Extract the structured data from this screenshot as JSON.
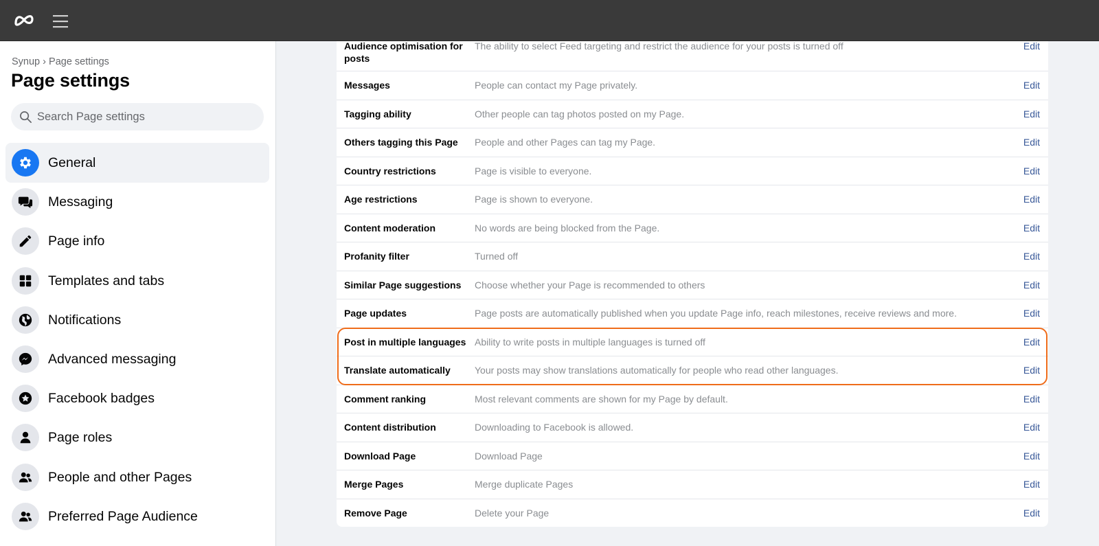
{
  "topbar": {
    "logo_icon": "meta-logo-icon",
    "menu_icon": "hamburger-menu-icon"
  },
  "sidebar": {
    "breadcrumb": {
      "parent": "Synup",
      "separator": "›",
      "current": "Page settings"
    },
    "title": "Page settings",
    "search": {
      "placeholder": "Search Page settings",
      "value": ""
    },
    "items": [
      {
        "label": "General",
        "icon": "gear-icon",
        "active": true
      },
      {
        "label": "Messaging",
        "icon": "chat-bubbles-icon"
      },
      {
        "label": "Page info",
        "icon": "pencil-icon"
      },
      {
        "label": "Templates and tabs",
        "icon": "grid-icon"
      },
      {
        "label": "Notifications",
        "icon": "globe-icon"
      },
      {
        "label": "Advanced messaging",
        "icon": "messenger-icon"
      },
      {
        "label": "Facebook badges",
        "icon": "star-badge-icon"
      },
      {
        "label": "Page roles",
        "icon": "person-icon"
      },
      {
        "label": "People and other Pages",
        "icon": "people-icon"
      },
      {
        "label": "Preferred Page Audience",
        "icon": "people-icon"
      }
    ]
  },
  "settings": {
    "edit_label": "Edit",
    "highlight_color": "#ef6c1a",
    "rows": [
      {
        "name": "Audience optimisation for posts",
        "desc": "The ability to select Feed targeting and restrict the audience for your posts is turned off"
      },
      {
        "name": "Messages",
        "desc": "People can contact my Page privately."
      },
      {
        "name": "Tagging ability",
        "desc": "Other people can tag photos posted on my Page."
      },
      {
        "name": "Others tagging this Page",
        "desc": "People and other Pages can tag my Page."
      },
      {
        "name": "Country restrictions",
        "desc": "Page is visible to everyone."
      },
      {
        "name": "Age restrictions",
        "desc": "Page is shown to everyone."
      },
      {
        "name": "Content moderation",
        "desc": "No words are being blocked from the Page."
      },
      {
        "name": "Profanity filter",
        "desc": "Turned off"
      },
      {
        "name": "Similar Page suggestions",
        "desc": "Choose whether your Page is recommended to others"
      },
      {
        "name": "Page updates",
        "desc": "Page posts are automatically published when you update Page info, reach milestones, receive reviews and more."
      },
      {
        "name": "Post in multiple languages",
        "desc": "Ability to write posts in multiple languages is turned off"
      },
      {
        "name": "Translate automatically",
        "desc": "Your posts may show translations automatically for people who read other languages."
      },
      {
        "name": "Comment ranking",
        "desc": "Most relevant comments are shown for my Page by default."
      },
      {
        "name": "Content distribution",
        "desc": "Downloading to Facebook is allowed."
      },
      {
        "name": "Download Page",
        "desc": "Download Page"
      },
      {
        "name": "Merge Pages",
        "desc": "Merge duplicate Pages"
      },
      {
        "name": "Remove Page",
        "desc": "Delete your Page"
      }
    ]
  }
}
